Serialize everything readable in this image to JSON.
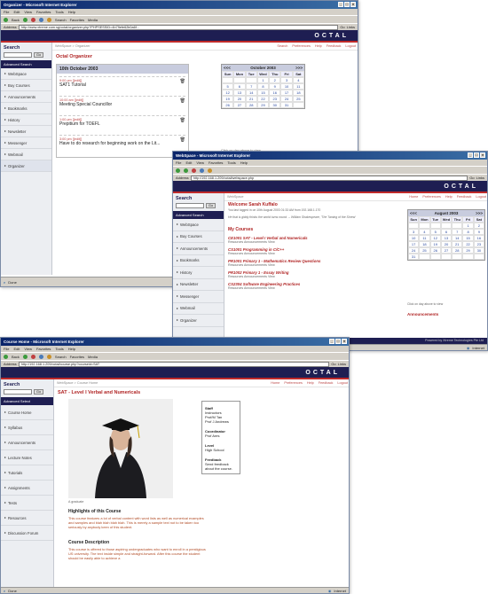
{
  "win1": {
    "title": "Organizer - Microsoft Internet Explorer",
    "menu": [
      "File",
      "Edit",
      "View",
      "Favorites",
      "Tools",
      "Help"
    ],
    "toolbar": [
      "Back",
      "Search",
      "Favorites",
      "Media"
    ],
    "address_label": "Address",
    "address": "http://www.xtreme.com.sg/octal/organizer.php?PHPSESSID=4b79efe62b0a6f...",
    "go": "Go",
    "links": "Links",
    "brand": "OCTAL",
    "sidebar": {
      "title": "Search",
      "go": "Go",
      "advanced": "Advanced Search",
      "items": [
        "WebSpace",
        "Buy Courses",
        "Announcements",
        "Bookmarks",
        "History",
        "Newsletter",
        "Messenger",
        "Webmail",
        "Organizer"
      ]
    },
    "crumbs": {
      "path": "WebSpace > Organizer",
      "links": [
        "Search",
        "Preferences",
        "Help",
        "Feedback",
        "Logout"
      ]
    },
    "heading": "Octal Organizer",
    "date_heading": "10th October 2003",
    "events": [
      {
        "time": "9:00 pm [[edit]]",
        "desc": "SAT1 Tutorial"
      },
      {
        "time": "10:00 am [[edit]]",
        "desc": "Meeting Special Councillor"
      },
      {
        "time": "1:00 pm [[edit]]",
        "desc": "Prepitium for TOEFL"
      },
      {
        "time": "3:00 pm [[edit]]",
        "desc": "Have to do research for beginning work on the Lit..."
      }
    ],
    "calendar": {
      "nav_prev": "<<<",
      "nav_next": ">>>",
      "month": "October 2003",
      "days": [
        "Sun",
        "Mon",
        "Tue",
        "Wed",
        "Thu",
        "Fri",
        "Sat"
      ],
      "cells": [
        "",
        "",
        "",
        "1",
        "2",
        "3",
        "4",
        "5",
        "6",
        "7",
        "8",
        "9",
        "10",
        "11",
        "12",
        "13",
        "14",
        "15",
        "16",
        "17",
        "18",
        "19",
        "20",
        "21",
        "22",
        "23",
        "24",
        "25",
        "26",
        "27",
        "28",
        "29",
        "30",
        "31",
        ""
      ],
      "note": "Click on day above to view"
    },
    "event_for": "Event for 10th October 2003",
    "status": "Done"
  },
  "win2": {
    "title": "WebSpace - Microsoft Internet Explorer",
    "menu": [
      "File",
      "Edit",
      "View",
      "Favorites",
      "Tools",
      "Help"
    ],
    "address_label": "Address",
    "address": "http://192.168.1.209/octal/webspace.php",
    "go": "Go",
    "links": "Links",
    "brand": "OCTAL",
    "sidebar": {
      "title": "Search",
      "go": "Go",
      "advanced": "Advanced Search",
      "items": [
        "WebSpace",
        "Buy Courses",
        "Announcements",
        "Bookmarks",
        "History",
        "Newsletter",
        "Messenger",
        "Webmail",
        "Organizer"
      ]
    },
    "crumbs": {
      "path": "WebSpace",
      "links": [
        "Home",
        "Preferences",
        "Help",
        "Feedback",
        "Logout"
      ]
    },
    "welcome": "Welcome Sarah Kuffalo",
    "last_login": "You last logged in on 10th August 2003 01:33 AM from 192.168.1.170",
    "quote": "He that is giddy thinks the world turns round. -- William Shakespeare, 'The Taming of the Shrew'",
    "my_courses": "My Courses",
    "courses": [
      {
        "code": "CE1001",
        "name": "SAT - Level I Verbal and Numericals",
        "sub": "Resources  Announcements  View"
      },
      {
        "code": "CS1001",
        "name": "Programming in C/C++",
        "sub": "Resources  Announcements  View"
      },
      {
        "code": "PR1001",
        "name": "Primary 1 - Mathematics Review Questions",
        "sub": "Resources  Announcements  View"
      },
      {
        "code": "PR1002",
        "name": "Primary 1 - Essay Writing",
        "sub": "Resources  Announcements  View"
      },
      {
        "code": "CS2304",
        "name": "Software Engineering Practices",
        "sub": "Resources  Announcements  View"
      }
    ],
    "calendar": {
      "nav_prev": "<<<",
      "nav_next": ">>>",
      "month": "August 2003",
      "days": [
        "Sun",
        "Mon",
        "Tue",
        "Wed",
        "Thu",
        "Fri",
        "Sat"
      ],
      "cells": [
        "",
        "",
        "",
        "",
        "",
        "1",
        "2",
        "3",
        "4",
        "5",
        "6",
        "7",
        "8",
        "9",
        "10",
        "11",
        "12",
        "13",
        "14",
        "15",
        "16",
        "17",
        "18",
        "19",
        "20",
        "21",
        "22",
        "23",
        "24",
        "25",
        "26",
        "27",
        "28",
        "29",
        "30",
        "31",
        "",
        "",
        "",
        "",
        "",
        ""
      ],
      "note": "Click on day above to view"
    },
    "announcements": "Announcements",
    "footer": "Powered by Xtreme Technologies Pte Ltd",
    "status_zone": "Internet"
  },
  "win3": {
    "title": "Course Home - Microsoft Internet Explorer",
    "menu": [
      "File",
      "Edit",
      "View",
      "Favorites",
      "Tools",
      "Help"
    ],
    "toolbar": [
      "Back",
      "Search",
      "Favorites",
      "Media"
    ],
    "address_label": "Address",
    "address": "http://192.168.1.209/octal/course.php?courseid=SAT",
    "go": "Go",
    "links": "Links",
    "brand": "OCTAL",
    "sidebar": {
      "title": "Search",
      "go": "Go",
      "advanced": "Advanced Select",
      "items": [
        "Course Home",
        "Syllabus",
        "Announcements",
        "Lecture Notes",
        "Tutorials",
        "Assignments",
        "Tests",
        "Resources",
        "Discussion Forum"
      ]
    },
    "crumbs": {
      "path": "WebSpace > Course Home",
      "links": [
        "Home",
        "Preferences",
        "Help",
        "Feedback",
        "Logout"
      ]
    },
    "course_title": "SAT - Level I Verbal and Numericals",
    "caption": "A graduate",
    "info": {
      "staff_label": "Staff",
      "staff": [
        "Instructors",
        "Prof/M Tan",
        "Prof J Andrews"
      ],
      "coord_label": "Coordinator",
      "coord": "Prof Ares",
      "level_label": "Level",
      "level": "High School",
      "feedback_label": "Feedback",
      "feedback": "Send feedback about the course."
    },
    "highlights_title": "Highlights of this Course",
    "highlights": "This course features a lot of verbal content with word lists as well as numerical examples and samples and blah blah blah blah. This is merely a sample text not to be taken too seriously by anybody keen of this student.",
    "desc_title": "Course Description",
    "desc": "This course is offered to those aspiring undergraduates who want to enroll in a prestigious US university. The text inside simple and straight-forward. After this course the student should be easily able to achieve a",
    "status": "Done",
    "status_zone": "Internet"
  }
}
